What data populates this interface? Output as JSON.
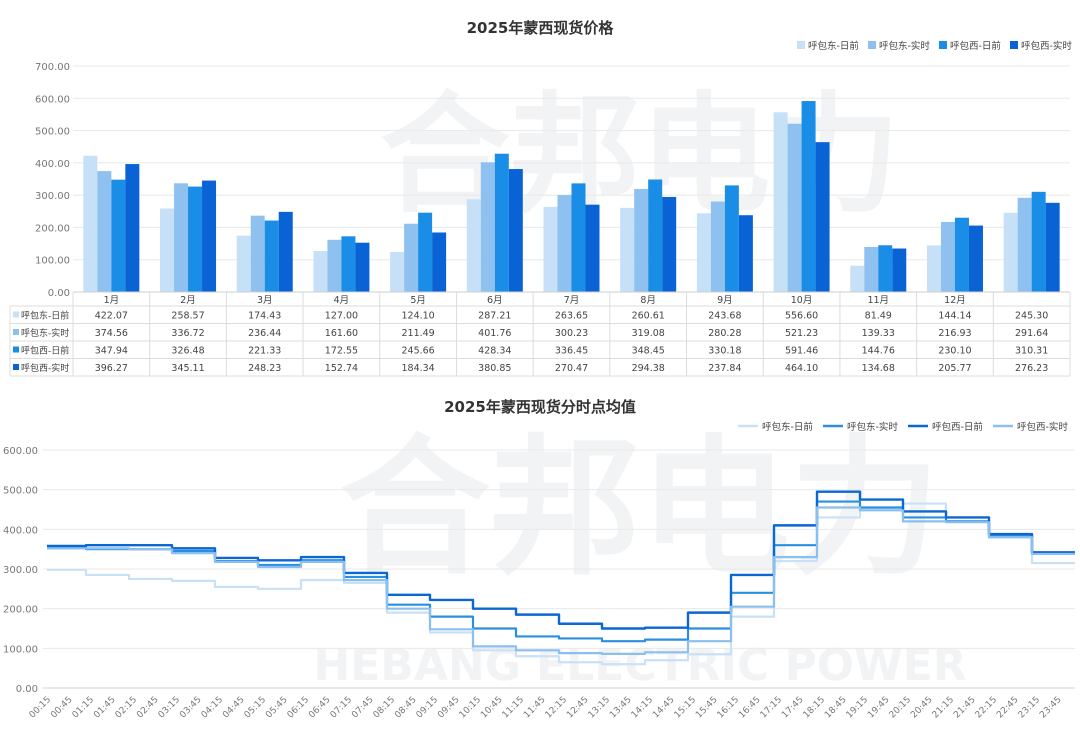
{
  "watermark": {
    "cn": "合邦电力",
    "en": "HEBANG ELECTRIC POWER"
  },
  "chart_data": [
    {
      "type": "bar",
      "title": "2025年蒙西现货价格",
      "categories": [
        "1月",
        "2月",
        "3月",
        "4月",
        "5月",
        "6月",
        "7月",
        "8月",
        "9月",
        "10月",
        "11月",
        "12月",
        ""
      ],
      "ylim": [
        0,
        700
      ],
      "yticks": [
        "0.00",
        "100.00",
        "200.00",
        "300.00",
        "400.00",
        "500.00",
        "600.00",
        "700.00"
      ],
      "grid": true,
      "legend_position": "top-right",
      "series": [
        {
          "name": "呼包东-日前",
          "color": "#c6e0f7",
          "values": [
            422.07,
            258.57,
            174.43,
            127.0,
            124.1,
            287.21,
            263.65,
            260.61,
            243.68,
            556.6,
            81.49,
            144.14,
            245.3
          ],
          "labels": [
            "422.07",
            "258.57",
            "174.43",
            "127.00",
            "124.10",
            "287.21",
            "263.65",
            "260.61",
            "243.68",
            "556.60",
            "81.49",
            "144.14",
            "245.30"
          ]
        },
        {
          "name": "呼包东-实时",
          "color": "#8ec1ef",
          "values": [
            374.56,
            336.72,
            236.44,
            161.6,
            211.49,
            401.76,
            300.23,
            319.08,
            280.28,
            521.23,
            139.33,
            216.93,
            291.64
          ],
          "labels": [
            "374.56",
            "336.72",
            "236.44",
            "161.60",
            "211.49",
            "401.76",
            "300.23",
            "319.08",
            "280.28",
            "521.23",
            "139.33",
            "216.93",
            "291.64"
          ]
        },
        {
          "name": "呼包西-日前",
          "color": "#1a8ee6",
          "values": [
            347.94,
            326.48,
            221.33,
            172.55,
            245.66,
            428.34,
            336.45,
            348.45,
            330.18,
            591.46,
            144.76,
            230.1,
            310.31
          ],
          "labels": [
            "347.94",
            "326.48",
            "221.33",
            "172.55",
            "245.66",
            "428.34",
            "336.45",
            "348.45",
            "330.18",
            "591.46",
            "144.76",
            "230.10",
            "310.31"
          ]
        },
        {
          "name": "呼包西-实时",
          "color": "#0a63d4",
          "values": [
            396.27,
            345.11,
            248.23,
            152.74,
            184.34,
            380.85,
            270.47,
            294.38,
            237.84,
            464.1,
            134.68,
            205.77,
            276.23
          ],
          "labels": [
            "396.27",
            "345.11",
            "248.23",
            "152.74",
            "184.34",
            "380.85",
            "270.47",
            "294.38",
            "237.84",
            "464.10",
            "134.68",
            "205.77",
            "276.23"
          ]
        }
      ]
    },
    {
      "type": "line",
      "title": "2025年蒙西现货分时点均值",
      "ylim": [
        0,
        600
      ],
      "yticks": [
        "0.00",
        "100.00",
        "200.00",
        "300.00",
        "400.00",
        "500.00",
        "600.00"
      ],
      "grid": true,
      "legend_position": "top-right",
      "x": [
        "00:15",
        "00:45",
        "01:15",
        "01:45",
        "02:15",
        "02:45",
        "03:15",
        "03:45",
        "04:15",
        "04:45",
        "05:15",
        "05:45",
        "06:15",
        "06:45",
        "07:15",
        "07:45",
        "08:15",
        "08:45",
        "09:15",
        "09:45",
        "10:15",
        "10:45",
        "11:15",
        "11:45",
        "12:15",
        "12:45",
        "13:15",
        "13:45",
        "14:15",
        "14:45",
        "15:15",
        "15:45",
        "16:15",
        "16:45",
        "17:15",
        "17:45",
        "18:15",
        "18:45",
        "19:15",
        "19:45",
        "20:15",
        "20:45",
        "21:15",
        "21:45",
        "22:15",
        "22:45",
        "23:15",
        "23:45"
      ],
      "series": [
        {
          "name": "呼包东-日前",
          "color": "#c9e1f6",
          "width": 2.2,
          "values": [
            298,
            298,
            285,
            285,
            275,
            275,
            270,
            270,
            255,
            255,
            250,
            250,
            272,
            272,
            265,
            265,
            190,
            190,
            140,
            140,
            95,
            95,
            80,
            80,
            65,
            65,
            60,
            60,
            70,
            70,
            85,
            85,
            180,
            180,
            320,
            320,
            430,
            430,
            450,
            450,
            465,
            465,
            420,
            420,
            380,
            380,
            315,
            315
          ]
        },
        {
          "name": "呼包东-实时",
          "color": "#2a8fe0",
          "width": 2.2,
          "values": [
            355,
            355,
            350,
            350,
            350,
            350,
            345,
            345,
            320,
            320,
            310,
            310,
            322,
            322,
            280,
            280,
            210,
            210,
            180,
            180,
            150,
            150,
            130,
            130,
            125,
            125,
            118,
            118,
            122,
            122,
            150,
            150,
            240,
            240,
            360,
            360,
            470,
            470,
            455,
            455,
            430,
            430,
            420,
            420,
            385,
            385,
            340,
            340
          ]
        },
        {
          "name": "呼包西-日前",
          "color": "#0b67d2",
          "width": 2.4,
          "values": [
            358,
            358,
            360,
            360,
            360,
            360,
            352,
            352,
            328,
            328,
            322,
            322,
            330,
            330,
            290,
            290,
            235,
            235,
            222,
            222,
            200,
            200,
            185,
            185,
            162,
            162,
            150,
            150,
            152,
            152,
            190,
            190,
            285,
            285,
            410,
            410,
            495,
            495,
            475,
            475,
            445,
            445,
            430,
            430,
            388,
            388,
            342,
            342
          ]
        },
        {
          "name": "呼包西-实时",
          "color": "#8bbfee",
          "width": 2.2,
          "values": [
            352,
            352,
            352,
            352,
            350,
            350,
            340,
            340,
            318,
            318,
            305,
            305,
            318,
            318,
            272,
            272,
            200,
            200,
            148,
            148,
            105,
            105,
            95,
            95,
            88,
            88,
            86,
            86,
            90,
            90,
            118,
            118,
            205,
            205,
            330,
            330,
            455,
            455,
            448,
            448,
            420,
            420,
            418,
            418,
            380,
            380,
            338,
            338
          ]
        }
      ]
    }
  ]
}
